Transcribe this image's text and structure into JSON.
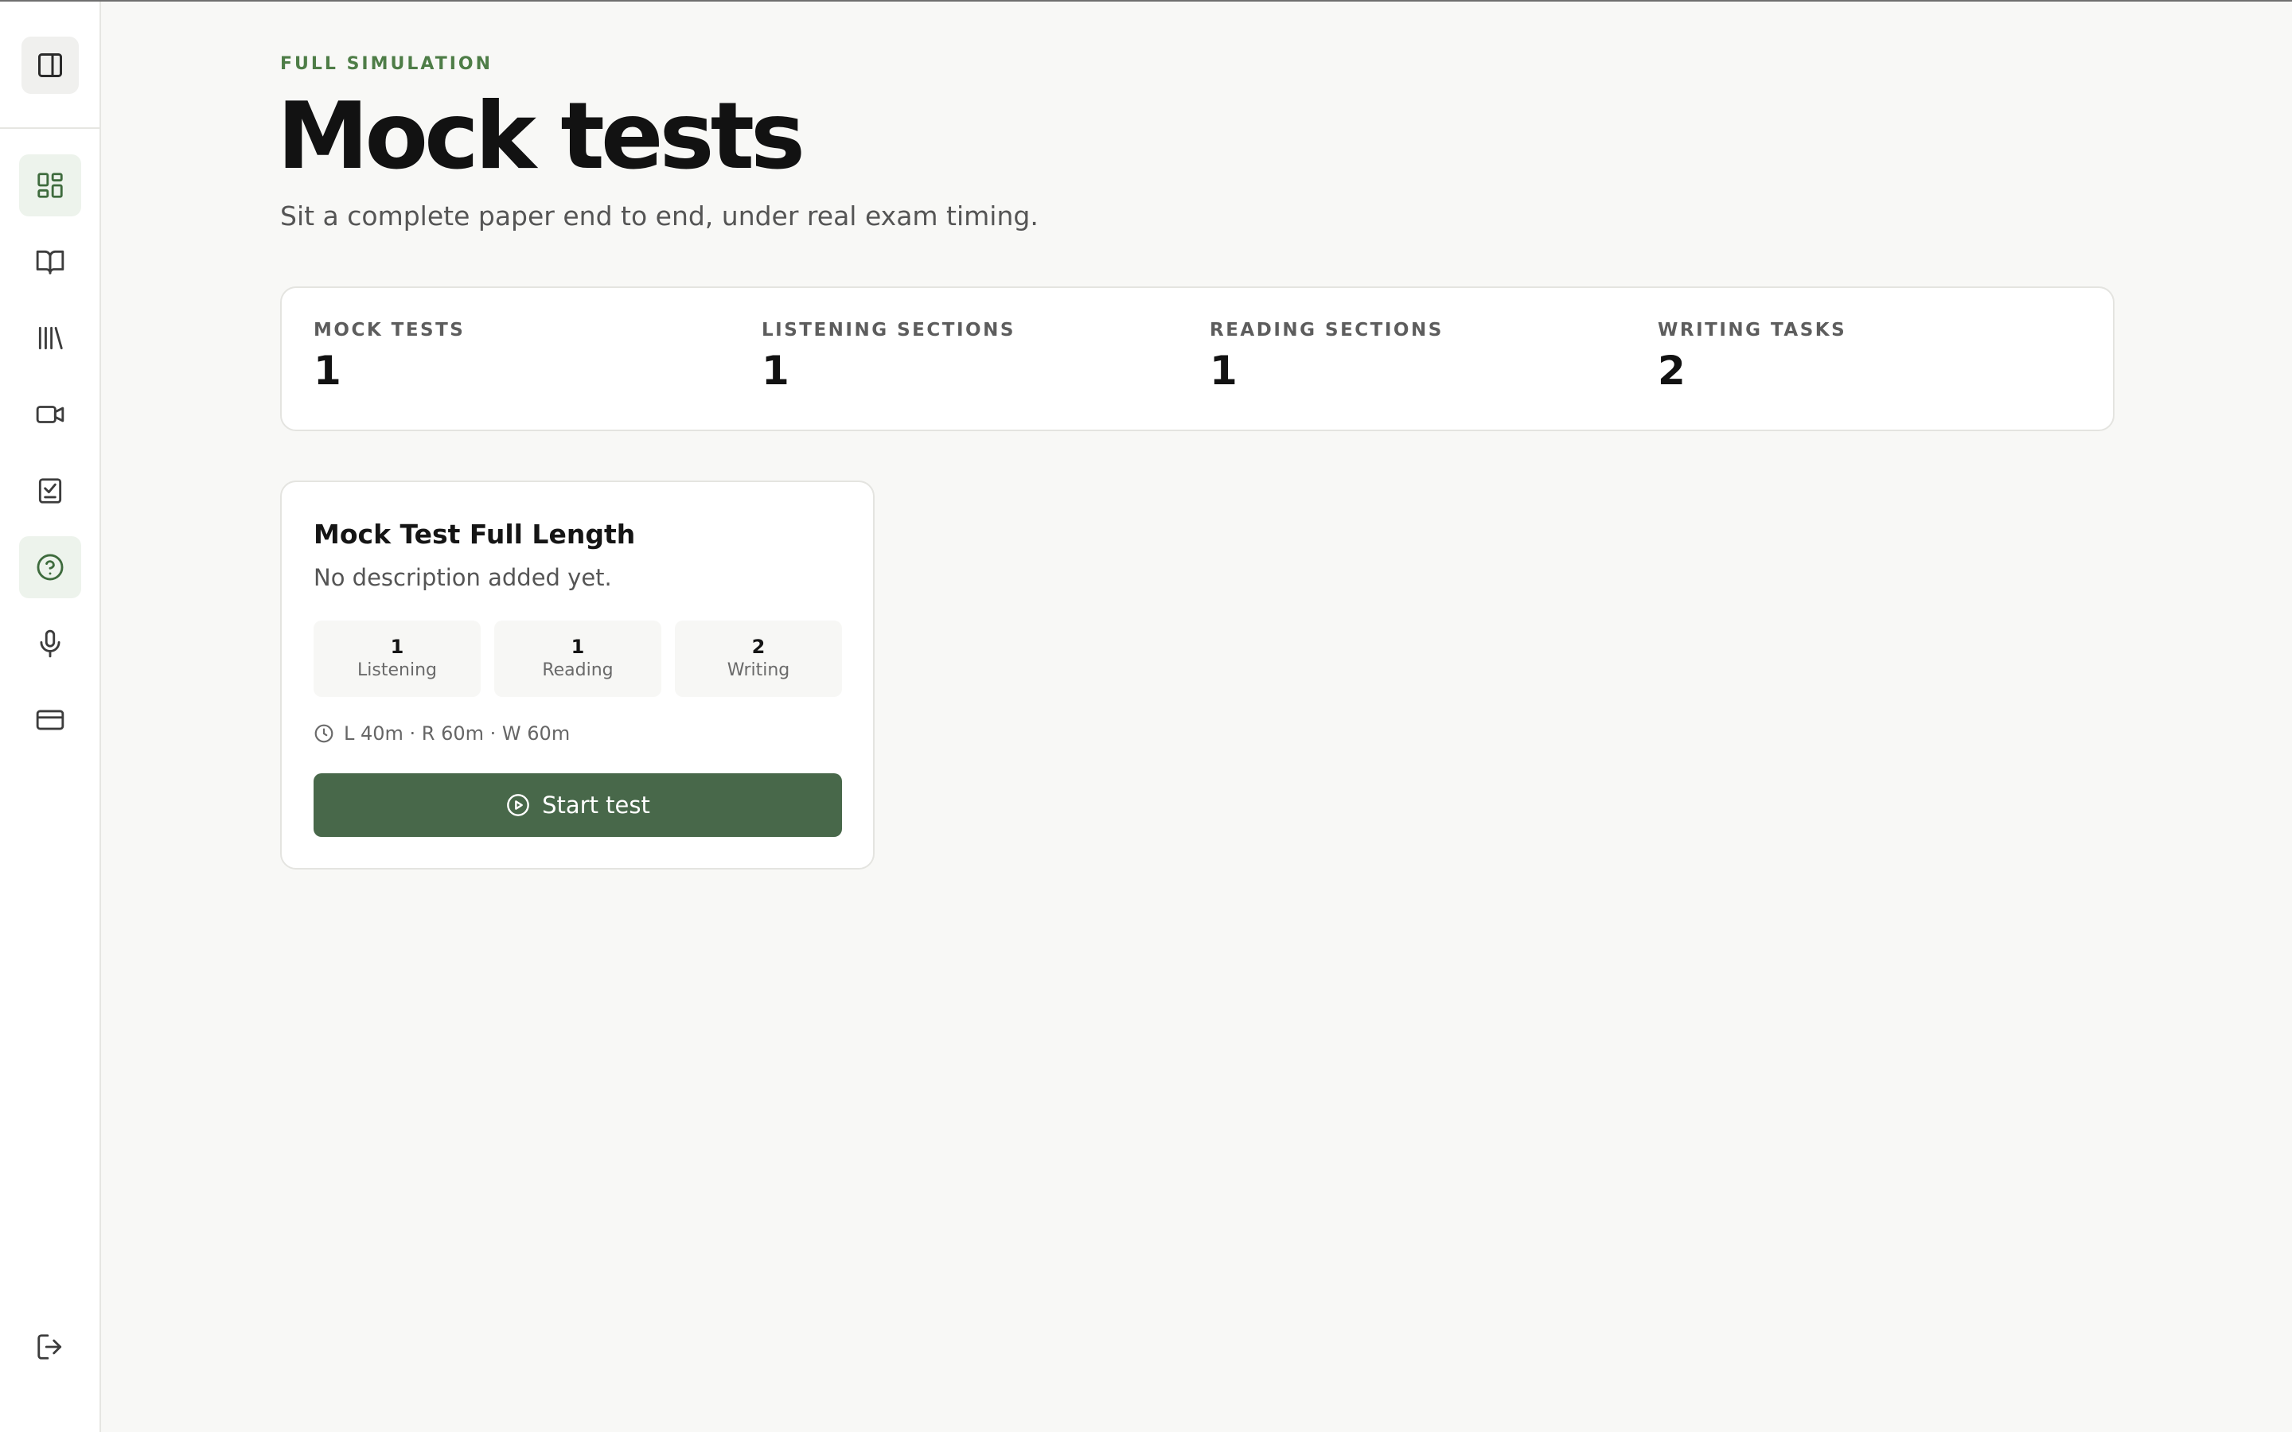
{
  "sidebar": {
    "toggle_icon": "sidebar-toggle-icon",
    "items": [
      {
        "key": "dashboard",
        "icon": "dashboard-icon",
        "active": true
      },
      {
        "key": "book",
        "icon": "open-book-icon",
        "active": false
      },
      {
        "key": "library",
        "icon": "library-icon",
        "active": false
      },
      {
        "key": "video",
        "icon": "video-camera-icon",
        "active": false
      },
      {
        "key": "tasks",
        "icon": "clipboard-check-icon",
        "active": false
      },
      {
        "key": "help",
        "icon": "help-circle-icon",
        "active": true
      },
      {
        "key": "speaking",
        "icon": "microphone-icon",
        "active": false
      },
      {
        "key": "billing",
        "icon": "credit-card-icon",
        "active": false
      }
    ],
    "logout_icon": "logout-icon"
  },
  "header": {
    "eyebrow": "FULL SIMULATION",
    "title": "Mock tests",
    "subtitle": "Sit a complete paper end to end, under real exam timing."
  },
  "stats": [
    {
      "label": "MOCK TESTS",
      "value": "1"
    },
    {
      "label": "LISTENING SECTIONS",
      "value": "1"
    },
    {
      "label": "READING SECTIONS",
      "value": "1"
    },
    {
      "label": "WRITING TASKS",
      "value": "2"
    }
  ],
  "card": {
    "title": "Mock Test Full Length",
    "description": "No description added yet.",
    "counts": [
      {
        "num": "1",
        "label": "Listening"
      },
      {
        "num": "1",
        "label": "Reading"
      },
      {
        "num": "2",
        "label": "Writing"
      }
    ],
    "timing": "L 40m · R 60m · W 60m",
    "button_label": "Start test"
  },
  "colors": {
    "accent": "#48684a",
    "eyebrow": "#4e7d47",
    "active_nav_bg": "#edf3ec",
    "icon": "#3c3c3c",
    "active_icon": "#3e6b3d"
  }
}
